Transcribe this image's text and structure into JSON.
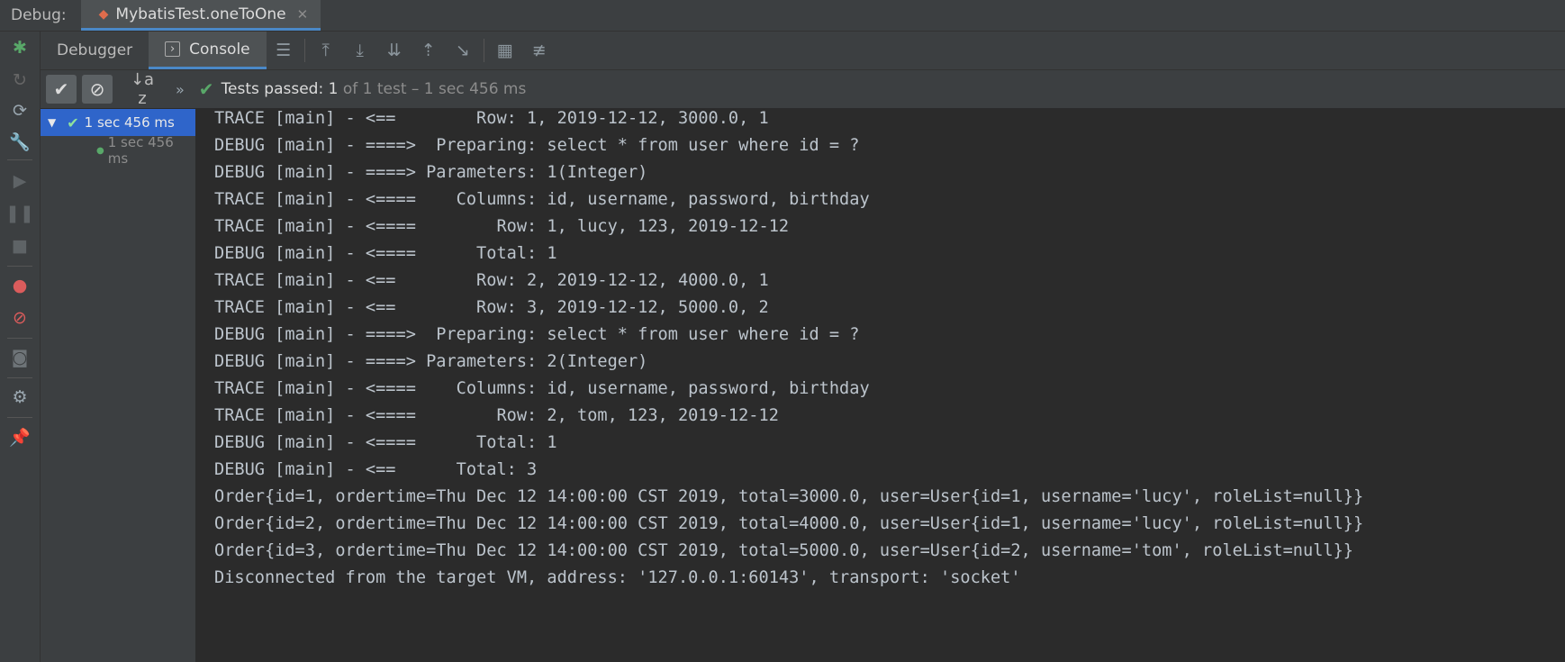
{
  "window": {
    "debug_label": "Debug:",
    "tab_title": "MybatisTest.oneToOne",
    "close_glyph": "✕"
  },
  "toolbar": {
    "debugger_label": "Debugger",
    "console_label": "Console"
  },
  "testbar": {
    "status_main": "Tests passed: 1",
    "status_rest": " of 1 test – 1 sec 456 ms",
    "sort_glyph": "↓a z"
  },
  "tree": {
    "root_time": "1 sec 456 ms",
    "child_time": "1 sec 456 ms"
  },
  "console": {
    "lines": [
      "TRACE [main] - <==        Row: 1, 2019-12-12, 3000.0, 1",
      "DEBUG [main] - ====>  Preparing: select * from user where id = ?",
      "DEBUG [main] - ====> Parameters: 1(Integer)",
      "TRACE [main] - <====    Columns: id, username, password, birthday",
      "TRACE [main] - <====        Row: 1, lucy, 123, 2019-12-12",
      "DEBUG [main] - <====      Total: 1",
      "TRACE [main] - <==        Row: 2, 2019-12-12, 4000.0, 1",
      "TRACE [main] - <==        Row: 3, 2019-12-12, 5000.0, 2",
      "DEBUG [main] - ====>  Preparing: select * from user where id = ?",
      "DEBUG [main] - ====> Parameters: 2(Integer)",
      "TRACE [main] - <====    Columns: id, username, password, birthday",
      "TRACE [main] - <====        Row: 2, tom, 123, 2019-12-12",
      "DEBUG [main] - <====      Total: 1",
      "DEBUG [main] - <==      Total: 3",
      "Order{id=1, ordertime=Thu Dec 12 14:00:00 CST 2019, total=3000.0, user=User{id=1, username='lucy', roleList=null}}",
      "Order{id=2, ordertime=Thu Dec 12 14:00:00 CST 2019, total=4000.0, user=User{id=1, username='lucy', roleList=null}}",
      "Order{id=3, ordertime=Thu Dec 12 14:00:00 CST 2019, total=5000.0, user=User{id=2, username='tom', roleList=null}}",
      "Disconnected from the target VM, address: '127.0.0.1:60143', transport: 'socket'"
    ]
  },
  "icons": {
    "left": [
      "bug-icon",
      "rerun-icon",
      "rerun-failed-icon",
      "wrench-icon",
      "resume-icon",
      "pause-icon",
      "stop-icon",
      "view-breakpoints-icon",
      "mute-breakpoints-icon",
      "camera-icon",
      "settings-icon",
      "pin-icon"
    ],
    "toolbar": [
      "menu-icon",
      "show-execution-point-icon",
      "step-over-icon",
      "step-into-icon",
      "step-out-icon",
      "run-to-cursor-icon",
      "evaluate-icon",
      "trace-icon"
    ]
  },
  "colors": {
    "accent": "#4a88c7",
    "passed": "#59a869",
    "selection": "#2f65ca"
  }
}
